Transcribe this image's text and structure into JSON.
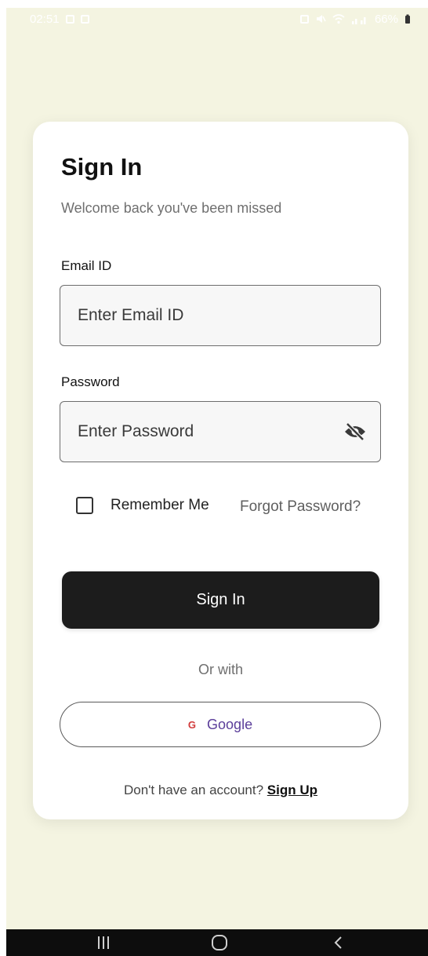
{
  "status_bar": {
    "time": "02:51",
    "battery": "66%",
    "left_icons": [
      "notification-icon",
      "image-icon"
    ],
    "right_icons": [
      "alarm-icon",
      "mute-icon",
      "wifi-icon",
      "signal-icon",
      "battery-icon"
    ]
  },
  "card": {
    "title": "Sign In",
    "subtitle": "Welcome back you've been missed",
    "email": {
      "label": "Email ID",
      "placeholder": "Enter Email ID",
      "value": ""
    },
    "password": {
      "label": "Password",
      "placeholder": "Enter Password",
      "value": "",
      "toggle_icon": "eye-off-icon"
    },
    "remember_label": "Remember Me",
    "remember_checked": false,
    "forgot_label": "Forgot Password?",
    "signin_label": "Sign In",
    "or_with": "Or with",
    "google_icon_text": "G",
    "google_label": "Google",
    "signup_prompt": "Don't have an account?",
    "signup_link": "Sign Up"
  },
  "nav_bar": {
    "icons": [
      "recent-apps-icon",
      "home-icon",
      "back-icon"
    ]
  },
  "colors": {
    "background": "#f4f4e1",
    "card": "#ffffff",
    "primary_button": "#1c1c1c",
    "google_g": "#d23b3b",
    "google_label": "#5b3e9a",
    "nav_bar": "#0d0d0d"
  }
}
